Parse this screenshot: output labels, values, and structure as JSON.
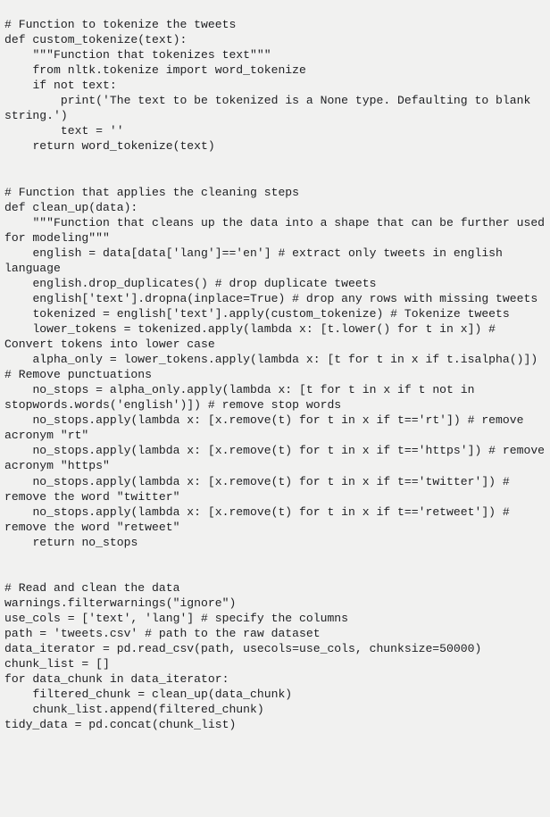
{
  "document": {
    "type": "code-snippet",
    "language": "python",
    "background_color": "#f1f1f0",
    "text_color": "#202124",
    "source_code": "# Function to tokenize the tweets\ndef custom_tokenize(text):\n    \"\"\"Function that tokenizes text\"\"\"\n    from nltk.tokenize import word_tokenize\n    if not text:\n        print('The text to be tokenized is a None type. Defaulting to blank string.')\n        text = ''\n    return word_tokenize(text)\n\n\n# Function that applies the cleaning steps\ndef clean_up(data):\n    \"\"\"Function that cleans up the data into a shape that can be further used for modeling\"\"\"\n    english = data[data['lang']=='en'] # extract only tweets in english language\n    english.drop_duplicates() # drop duplicate tweets\n    english['text'].dropna(inplace=True) # drop any rows with missing tweets\n    tokenized = english['text'].apply(custom_tokenize) # Tokenize tweets\n    lower_tokens = tokenized.apply(lambda x: [t.lower() for t in x]) # Convert tokens into lower case\n    alpha_only = lower_tokens.apply(lambda x: [t for t in x if t.isalpha()]) # Remove punctuations\n    no_stops = alpha_only.apply(lambda x: [t for t in x if t not in stopwords.words('english')]) # remove stop words\n    no_stops.apply(lambda x: [x.remove(t) for t in x if t=='rt']) # remove acronym \"rt\"\n    no_stops.apply(lambda x: [x.remove(t) for t in x if t=='https']) # remove acronym \"https\"\n    no_stops.apply(lambda x: [x.remove(t) for t in x if t=='twitter']) # remove the word \"twitter\"\n    no_stops.apply(lambda x: [x.remove(t) for t in x if t=='retweet']) # remove the word \"retweet\"\n    return no_stops\n\n\n# Read and clean the data\nwarnings.filterwarnings(\"ignore\")\nuse_cols = ['text', 'lang'] # specify the columns\npath = 'tweets.csv' # path to the raw dataset\ndata_iterator = pd.read_csv(path, usecols=use_cols, chunksize=50000)\nchunk_list = []\nfor data_chunk in data_iterator:\n    filtered_chunk = clean_up(data_chunk)\n    chunk_list.append(filtered_chunk)\ntidy_data = pd.concat(chunk_list)"
  }
}
